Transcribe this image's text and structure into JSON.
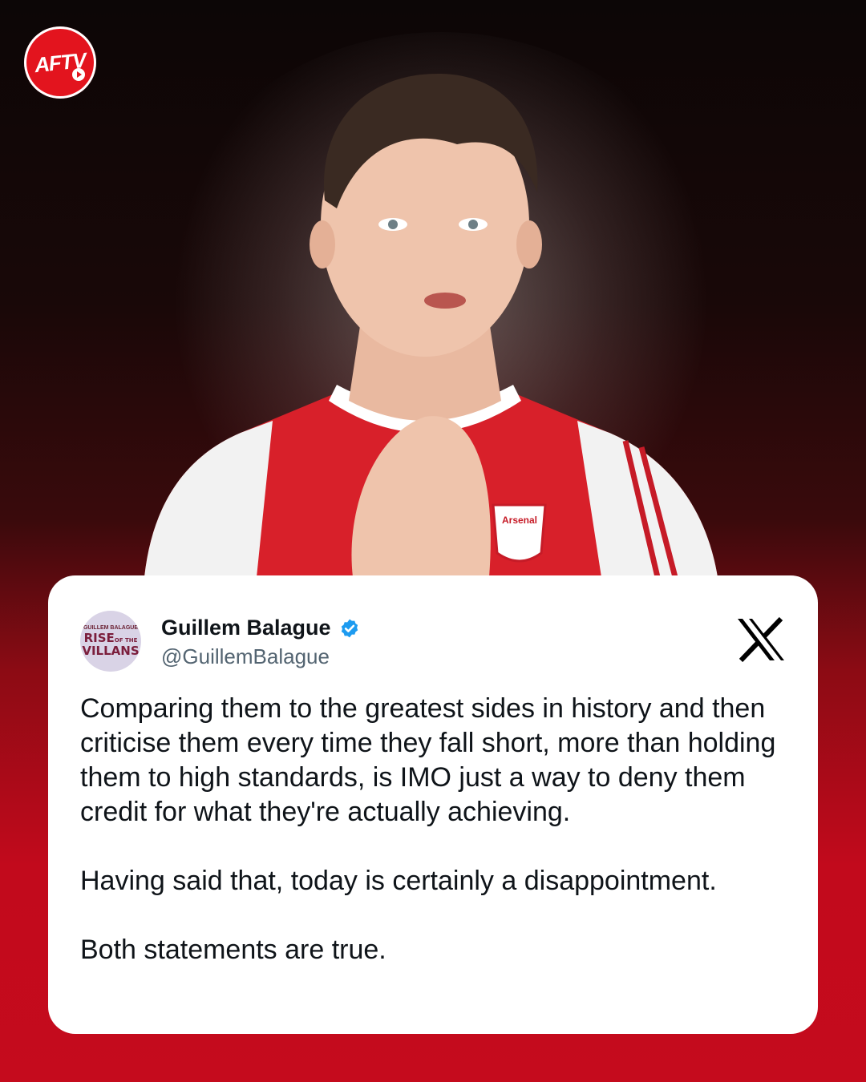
{
  "brand": {
    "logo_text": "AFTV"
  },
  "post": {
    "author_name": "Guillem Balague",
    "author_handle": "@GuillemBalague",
    "verified": true,
    "avatar": {
      "top": "GUILLEM BALAGUE",
      "line1": "RISE",
      "line1_small": "OF THE",
      "line2": "VILLANS"
    },
    "platform_icon": "x-logo-icon",
    "paragraphs": [
      "Comparing them to the greatest sides in history and then criticise them every time they fall short, more than holding them to high standards, is IMO just a way to deny them credit for what they're actually achieving.",
      "Having said that, today is certainly a disappointment.",
      "Both statements are true."
    ]
  },
  "colors": {
    "accent_red": "#c50b1d",
    "verified_blue": "#1d9bf0",
    "text": "#0f1419",
    "muted": "#536471"
  }
}
